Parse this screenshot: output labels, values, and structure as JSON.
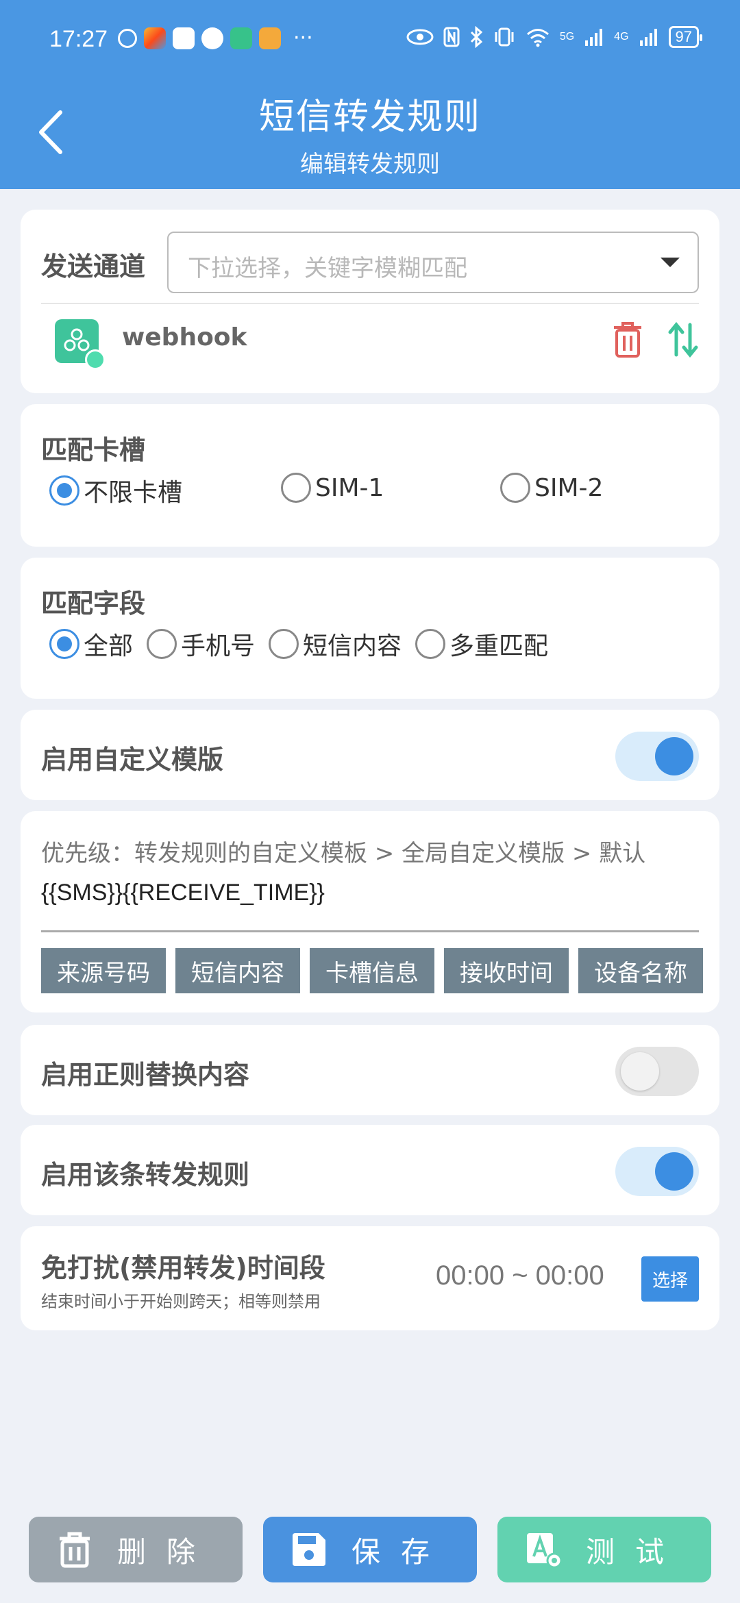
{
  "status_bar": {
    "time": "17:27",
    "battery": "97",
    "net1": "5G",
    "net2": "4G"
  },
  "header": {
    "title": "短信转发规则",
    "subtitle": "编辑转发规则"
  },
  "channel": {
    "label": "发送通道",
    "placeholder": "下拉选择，关键字模糊匹配",
    "selected_item": "webhook"
  },
  "sim_slot": {
    "title": "匹配卡槽",
    "options": [
      "不限卡槽",
      "SIM-1",
      "SIM-2"
    ],
    "selected": "不限卡槽"
  },
  "match_field": {
    "title": "匹配字段",
    "options": [
      "全部",
      "手机号",
      "短信内容",
      "多重匹配"
    ],
    "selected": "全部"
  },
  "custom_template": {
    "label": "启用自定义模版",
    "enabled": true
  },
  "template_body": {
    "priority": "优先级：转发规则的自定义模板 > 全局自定义模版 > 默认",
    "template": "{{SMS}}{{RECEIVE_TIME}}",
    "chips": [
      "来源号码",
      "短信内容",
      "卡槽信息",
      "接收时间",
      "设备名称"
    ]
  },
  "regex_replace": {
    "label": "启用正则替换内容",
    "enabled": false
  },
  "enable_rule": {
    "label": "启用该条转发规则",
    "enabled": true
  },
  "dnd": {
    "title": "免打扰(禁用转发)时间段",
    "subtitle": "结束时间小于开始则跨天；相等则禁用",
    "time": "00:00 ~ 00:00",
    "button": "选择"
  },
  "buttons": {
    "delete": "删除",
    "save": "保存",
    "test": "测试"
  },
  "colors": {
    "primary": "#4a97e3",
    "accent": "#3c8ee2",
    "teal": "#62d2b0",
    "grey": "#9ca6ae",
    "chip": "#6f8390"
  }
}
